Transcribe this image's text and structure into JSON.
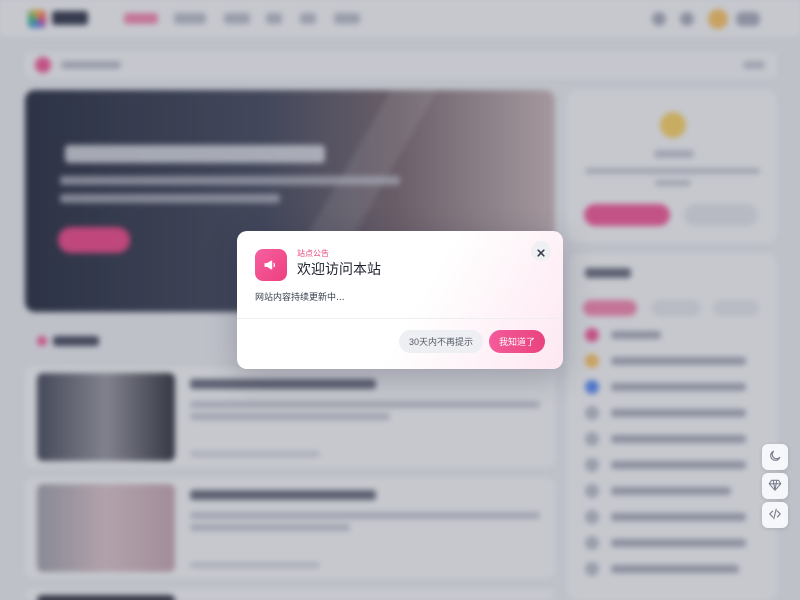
{
  "notice": {
    "eyebrow": "站点公告",
    "title": "欢迎访问本站",
    "body": "网站内容持续更新中...",
    "skip_label": "30天内不再提示",
    "ok_label": "我知道了",
    "icon": "megaphone-icon",
    "close_icon": "close-icon"
  },
  "float_tools": [
    "moon-icon",
    "diamond-icon",
    "code-icon"
  ],
  "colors": {
    "accent": "#ee4a86",
    "overlay": "#282e42",
    "page_bg": "#e9ebf0"
  }
}
